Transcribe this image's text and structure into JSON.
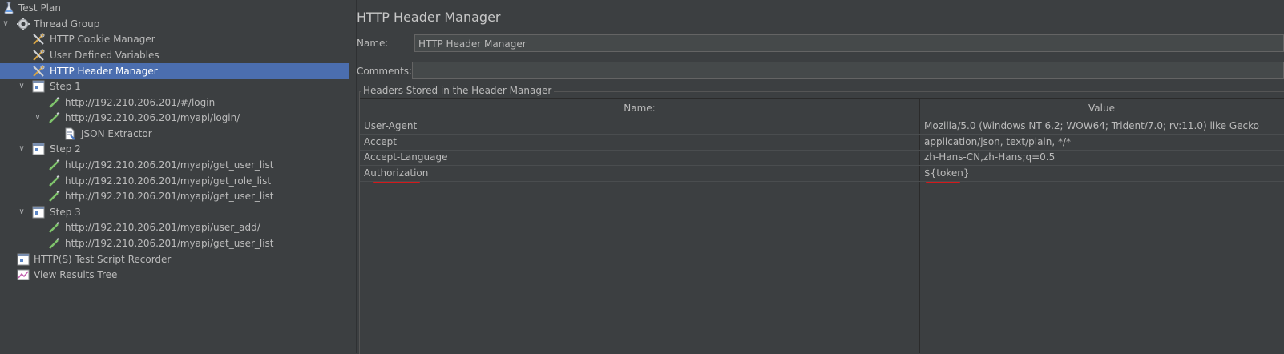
{
  "tree": {
    "items": [
      {
        "label": "Test Plan",
        "icon": "flask-icon"
      },
      {
        "label": "Thread Group",
        "icon": "gear-icon"
      },
      {
        "label": "HTTP Cookie Manager",
        "icon": "wrench-icon"
      },
      {
        "label": "User Defined Variables",
        "icon": "wrench-icon"
      },
      {
        "label": "HTTP Header Manager",
        "icon": "wrench-icon"
      },
      {
        "label": "Step 1",
        "icon": "controller-icon"
      },
      {
        "label": "http://192.210.206.201/#/login",
        "icon": "pipette-icon"
      },
      {
        "label": "http://192.210.206.201/myapi/login/",
        "icon": "pipette-icon"
      },
      {
        "label": "JSON Extractor",
        "icon": "extractor-icon"
      },
      {
        "label": "Step 2",
        "icon": "controller-icon"
      },
      {
        "label": "http://192.210.206.201/myapi/get_user_list",
        "icon": "pipette-icon"
      },
      {
        "label": "http://192.210.206.201/myapi/get_role_list",
        "icon": "pipette-icon"
      },
      {
        "label": "http://192.210.206.201/myapi/get_user_list",
        "icon": "pipette-icon"
      },
      {
        "label": "Step 3",
        "icon": "controller-icon"
      },
      {
        "label": "http://192.210.206.201/myapi/user_add/",
        "icon": "pipette-icon"
      },
      {
        "label": "http://192.210.206.201/myapi/get_user_list",
        "icon": "pipette-icon"
      },
      {
        "label": "HTTP(S) Test Script Recorder",
        "icon": "recorder-icon"
      },
      {
        "label": "View Results Tree",
        "icon": "chart-icon"
      }
    ],
    "selected": "HTTP Header Manager"
  },
  "panel": {
    "title": "HTTP Header Manager",
    "name_label": "Name:",
    "name_value": "HTTP Header Manager",
    "comments_label": "Comments:",
    "comments_value": "",
    "group_title": "Headers Stored in the Header Manager"
  },
  "headers_table": {
    "columns": [
      "Name:",
      "Value"
    ],
    "rows": [
      {
        "name": "User-Agent",
        "value": "Mozilla/5.0 (Windows NT 6.2; WOW64; Trident/7.0; rv:11.0) like Gecko"
      },
      {
        "name": "Accept",
        "value": "application/json, text/plain, */*"
      },
      {
        "name": "Accept-Language",
        "value": "zh-Hans-CN,zh-Hans;q=0.5"
      },
      {
        "name": "Authorization",
        "value": "${token}"
      }
    ]
  },
  "colors": {
    "background": "#3c3f41",
    "selection": "#4b6eaf",
    "annotation": "#d4191b"
  }
}
